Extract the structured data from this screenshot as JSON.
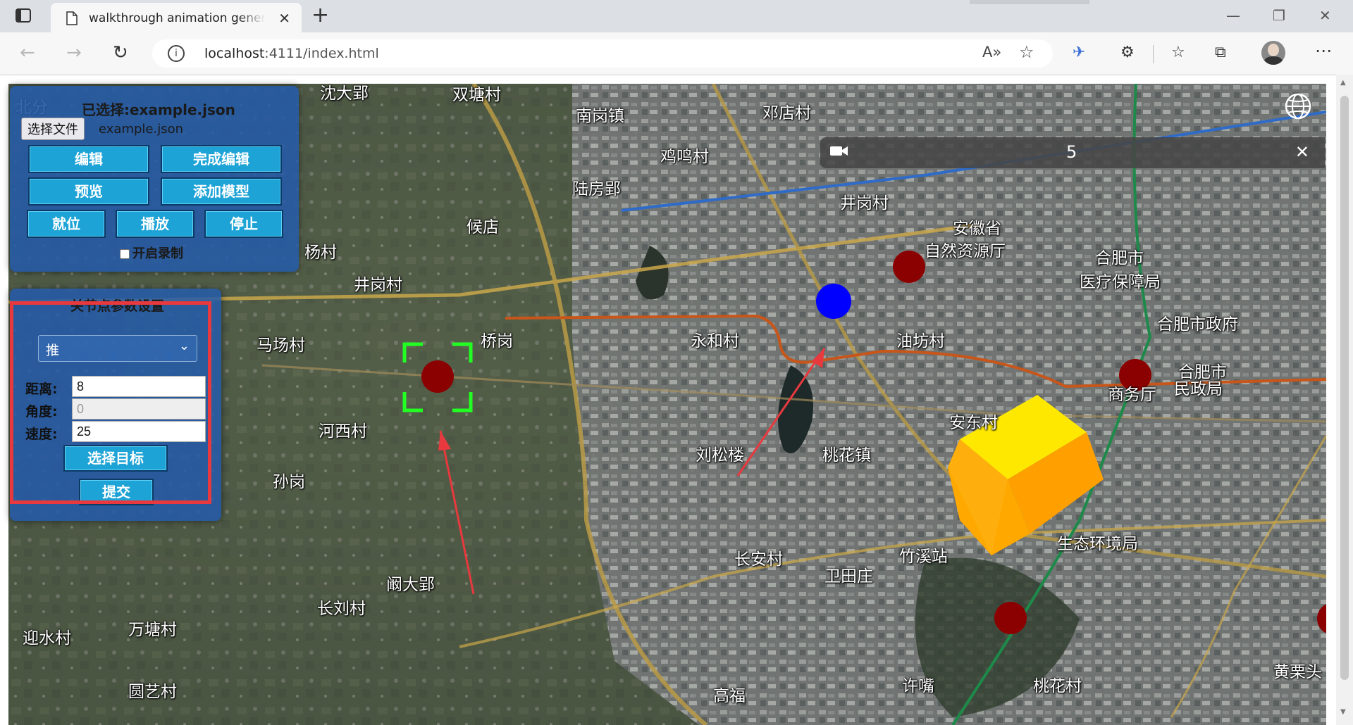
{
  "browser": {
    "tab_title": "walkthrough animation generator",
    "url_host": "localhost",
    "url_path": ":4111/index.html"
  },
  "panel": {
    "selected_label": "已选择:example.json",
    "file_button": "选择文件",
    "file_name": "example.json",
    "buttons": {
      "edit": "编辑",
      "finish_edit": "完成编辑",
      "preview": "预览",
      "add_model": "添加模型",
      "in_place": "就位",
      "play": "播放",
      "stop": "停止"
    },
    "record_label": "开启录制",
    "record_checked": false
  },
  "param_panel": {
    "title": "关节点参数设置",
    "select_value": "推",
    "distance_label": "距离:",
    "distance_value": "8",
    "angle_label": "角度:",
    "angle_value": "0",
    "speed_label": "速度:",
    "speed_value": "25",
    "select_target_button": "选择目标",
    "submit_button": "提交"
  },
  "timer": {
    "value": "5"
  },
  "map_labels": [
    "沈大郢",
    "双塘村",
    "北分",
    "南岗镇",
    "邓店村",
    "鸡鸣村",
    "陆房郢",
    "候店",
    "井岗村",
    "安徽省",
    "自然资源厅",
    "马场村",
    "井岗村",
    "合肥市",
    "医疗保障局",
    "合肥市政府",
    "永和村",
    "油坊村",
    "合肥市",
    "商务厅",
    "民政局",
    "河西村",
    "安东村",
    "刘松楼",
    "桃花镇",
    "孙岗",
    "长安村",
    "竹溪站",
    "卫田庄",
    "生态环境局",
    "阚大郢",
    "长刘村",
    "迎水村",
    "万塘村",
    "许嘴",
    "桃花村",
    "高福",
    "圆艺村",
    "黄栗头",
    "桥岗",
    "杨村"
  ],
  "colors": {
    "marker_red": "#8b0000",
    "marker_blue": "#0000ff",
    "cube_top": "#ffe800",
    "cube_front": "#ffa300",
    "selection_green": "#22ff22",
    "annotation_red": "#e8393e",
    "panel_blue": "#235aaa",
    "button_blue": "#1ea3d6"
  },
  "icons": [
    "sidebar-icon",
    "page-icon",
    "close-icon",
    "plus-icon",
    "minimize-icon",
    "restore-icon",
    "back-icon",
    "forward-icon",
    "refresh-icon",
    "info-icon",
    "read-aloud-icon",
    "favorite-add-icon",
    "extension-bird-icon",
    "extensions-icon",
    "favorites-icon",
    "collections-icon",
    "profile-avatar",
    "more-icon",
    "globe-icon",
    "camera-icon"
  ]
}
